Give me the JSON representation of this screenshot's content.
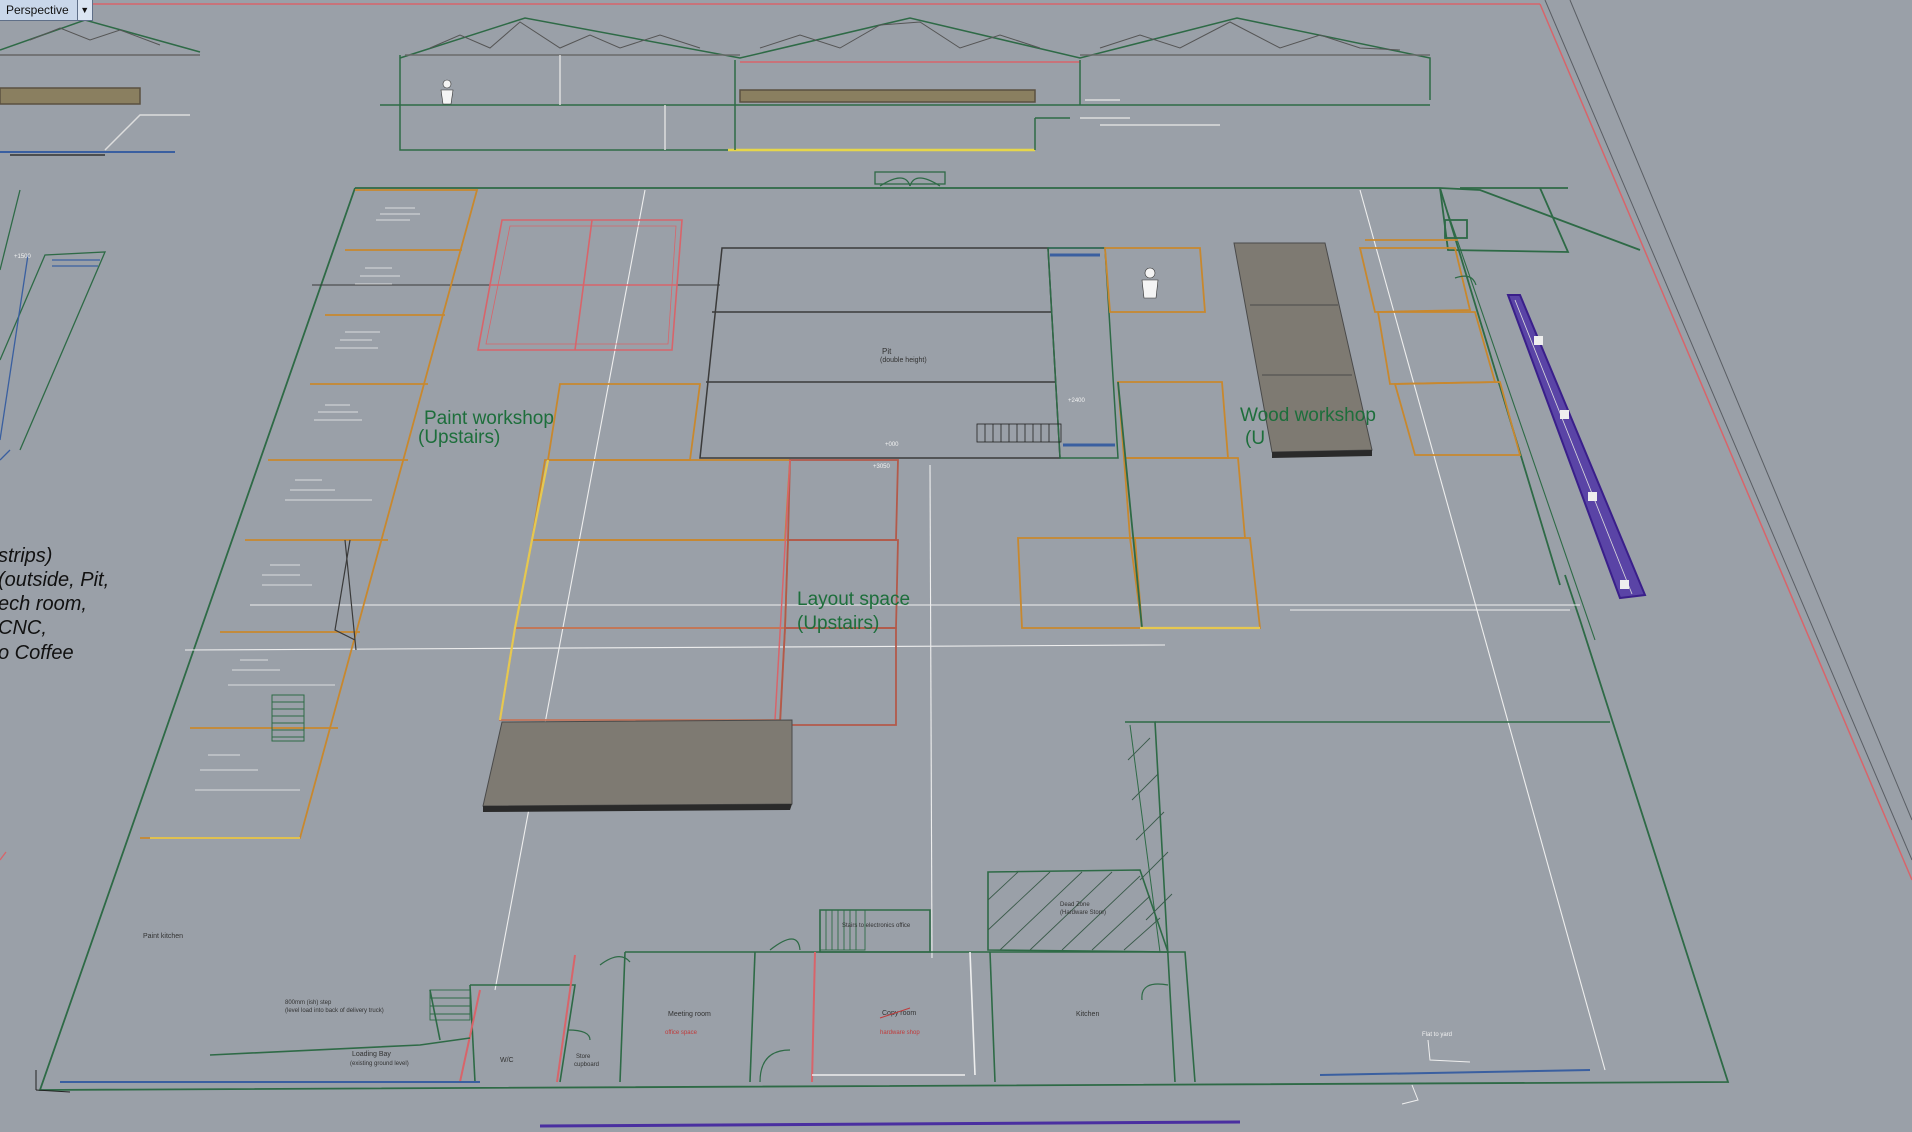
{
  "viewport": {
    "view_name": "Perspective",
    "view_dropdown_icon": "triangle-down-icon"
  },
  "labels": {
    "paint_workshop_line1": "Paint workshop",
    "paint_workshop_line2": "(Upstairs)",
    "layout_space_line1": "Layout space",
    "layout_space_line2": "(Upstairs)",
    "wood_workshop_line1": "Wood workshop",
    "wood_workshop_line2": "(U",
    "pit": "Pit",
    "pit_sub": "(double height)",
    "paint_kitchen": "Paint kitchen",
    "loading_bay_line1": "Loading Bay",
    "loading_bay_line2": "(existing ground level)",
    "step_note_line1": "800mm (ish) step",
    "step_note_line2": "(level load into back of delivery truck)",
    "wc": "W/C",
    "store_line1": "Store",
    "store_line2": "cupboard",
    "meeting_room": "Meeting room",
    "office_space": "office space",
    "copy_room": "Copy room",
    "hardware_shop": "hardware shop",
    "kitchen": "Kitchen",
    "stairs_note": "Stairs to electronics office",
    "dead_zone_line1": "Dead Zone",
    "dead_zone_line2": "(Hardware Store)",
    "flat_to_yard": "Flat to yard",
    "level_plus_000": "+000",
    "level_plus_3050": "+3050",
    "level_plus_2400": "+2400",
    "level_plus_1500": "+1500"
  },
  "partial_note": [
    "strips)",
    "(outside, Pit,",
    "ech room,",
    "CNC,",
    "o Coffee"
  ],
  "colors": {
    "background": "#9aa0a8",
    "green_wall": "#2e6a46",
    "orange_room": "#c8882e",
    "red_zone": "#d8646a",
    "purple_strip": "#4a2fa0",
    "dark_block": "#7e7a72",
    "white_line": "#f2f2f2",
    "label_green": "#1d6e3b"
  }
}
